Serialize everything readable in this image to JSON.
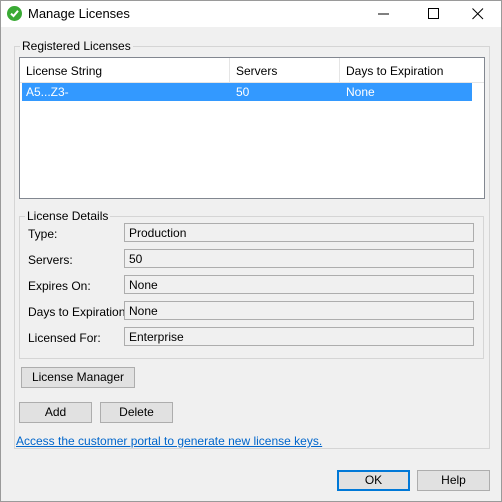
{
  "window": {
    "title": "Manage Licenses"
  },
  "registered": {
    "legend": "Registered Licenses",
    "columns": [
      "License String",
      "Servers",
      "Days to Expiration"
    ],
    "rows": [
      {
        "license": "A5...Z3-",
        "servers": "50",
        "days": "None"
      }
    ]
  },
  "details": {
    "legend": "License Details",
    "fields": [
      {
        "label": "Type:",
        "value": "Production"
      },
      {
        "label": "Servers:",
        "value": "50"
      },
      {
        "label": "Expires On:",
        "value": "None"
      },
      {
        "label": "Days to Expiration:",
        "value": "None"
      },
      {
        "label": "Licensed For:",
        "value": "Enterprise"
      }
    ]
  },
  "buttons": {
    "license_manager": "License Manager",
    "add": "Add",
    "delete": "Delete",
    "ok": "OK",
    "help": "Help"
  },
  "portal_link": "Access the customer portal to generate new license keys.",
  "colors": {
    "accent": "#0078d7",
    "selection": "#3399ff",
    "icon_green": "#3aaa35",
    "link": "#0066cc"
  }
}
